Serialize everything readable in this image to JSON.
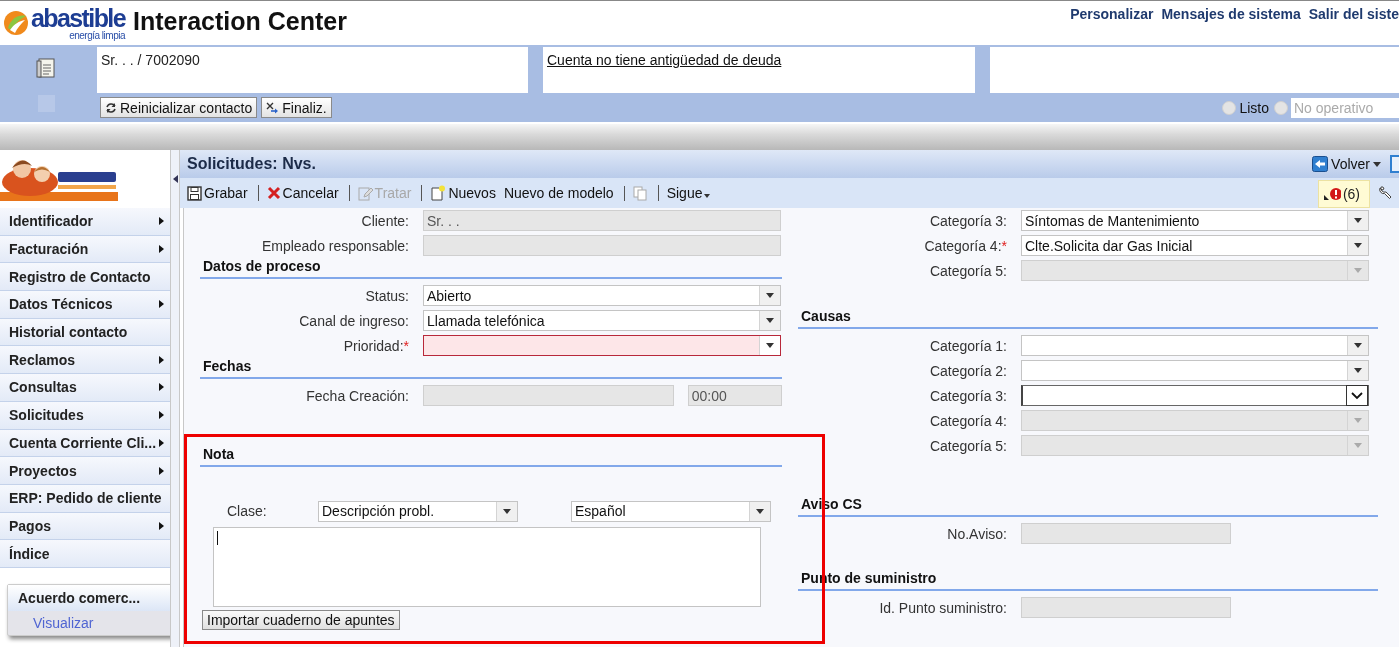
{
  "header": {
    "logo_text": "abastible",
    "logo_tagline": "energía limpia",
    "title": "Interaction Center",
    "links": [
      "Personalizar",
      "Mensajes de sistema",
      "Salir del siste"
    ]
  },
  "contact_bar": {
    "customer": "Sr. . . / 7002090",
    "debt_note": "Cuenta no tiene antigüedad de deuda",
    "buttons": [
      {
        "kind": "reset",
        "label": "Reinicializar contacto"
      },
      {
        "kind": "end",
        "label": "Finaliz."
      }
    ],
    "availability": [
      {
        "kind": "label",
        "label": "Listo",
        "selected": false
      },
      {
        "kind": "field",
        "placeholder": "No operativo",
        "selected": false
      }
    ]
  },
  "sidebar": {
    "items": [
      {
        "label": "Identificador",
        "submenu": true
      },
      {
        "label": "Facturación",
        "submenu": true
      },
      {
        "label": "Registro de Contacto",
        "submenu": false
      },
      {
        "label": "Datos Técnicos",
        "submenu": true
      },
      {
        "label": "Historial contacto",
        "submenu": false
      },
      {
        "label": "Reclamos",
        "submenu": true
      },
      {
        "label": "Consultas",
        "submenu": true
      },
      {
        "label": "Solicitudes",
        "submenu": true
      },
      {
        "label": "Cuenta Corriente Cli...",
        "submenu": true
      },
      {
        "label": "Proyectos",
        "submenu": true
      },
      {
        "label": "ERP: Pedido de cliente",
        "submenu": false
      },
      {
        "label": "Pagos",
        "submenu": true
      },
      {
        "label": "Índice",
        "submenu": false
      }
    ],
    "popup": {
      "title": "Acuerdo comerc...",
      "items": [
        "Visualizar"
      ]
    }
  },
  "page": {
    "title": "Solicitudes: Nvs.",
    "back": "Volver",
    "messages": "(6)",
    "toolbar": [
      {
        "kind": "save",
        "label": "Grabar",
        "disabled": false,
        "divider_before": false
      },
      {
        "kind": "cancel",
        "label": "Cancelar",
        "disabled": false,
        "divider_before": true
      },
      {
        "kind": "edit",
        "label": "Tratar",
        "disabled": true,
        "divider_before": true
      },
      {
        "kind": "new",
        "label": "Nuevos",
        "disabled": false,
        "divider_before": true
      },
      {
        "kind": "plain",
        "label": "Nuevo de modelo",
        "disabled": false,
        "divider_before": false
      },
      {
        "kind": "copy",
        "disabled": true,
        "divider_before": true
      },
      {
        "kind": "menu",
        "label": "Sigue",
        "disabled": false,
        "divider_before": true
      }
    ]
  },
  "left_sections": [
    {
      "fields": [
        {
          "label": "Cliente:",
          "value": "Sr. . .",
          "kind": "text",
          "disabled": true,
          "invalid": false,
          "focused": false
        },
        {
          "label": "Empleado responsable:",
          "kind": "text",
          "disabled": true,
          "invalid": false,
          "focused": false
        }
      ]
    },
    {
      "title": "Datos de proceso",
      "fields": [
        {
          "label": "Status:",
          "value": "Abierto",
          "kind": "dropdown",
          "disabled": false,
          "invalid": false,
          "focused": false
        },
        {
          "label": "Canal de ingreso:",
          "value": "Llamada telefónica",
          "kind": "dropdown",
          "disabled": false,
          "invalid": false,
          "focused": false
        },
        {
          "label": "Prioridad:",
          "required_mark": "*",
          "kind": "dropdown",
          "disabled": false,
          "invalid": true,
          "focused": false
        }
      ]
    },
    {
      "title": "Fechas",
      "fields": [
        {
          "label": "Fecha Creación:",
          "kind": "text",
          "time": "00:00",
          "disabled": true,
          "invalid": false,
          "focused": false
        }
      ]
    }
  ],
  "note": {
    "title": "Nota",
    "highlighted": true,
    "class_label": "Clase:",
    "class_value": "Descripción probl.",
    "language": "Español",
    "focused": true,
    "import_button": "Importar cuaderno de apuntes"
  },
  "right_sections": [
    {
      "fields": [
        {
          "label": "Categoría 3:",
          "value": "Síntomas de Mantenimiento",
          "kind": "dropdown",
          "disabled": false,
          "invalid": false,
          "focused": false
        },
        {
          "label": "Categoría 4:",
          "required_mark": "*",
          "value": "Clte.Solicita dar Gas Inicial",
          "kind": "dropdown",
          "disabled": false,
          "invalid": false,
          "focused": false
        },
        {
          "label": "Categoría 5:",
          "kind": "dropdown",
          "disabled": true,
          "invalid": false,
          "focused": false
        }
      ]
    },
    {
      "title": "Causas",
      "fields": [
        {
          "label": "Categoría 1:",
          "kind": "dropdown",
          "disabled": false,
          "invalid": false,
          "focused": false
        },
        {
          "label": "Categoría 2:",
          "kind": "dropdown",
          "disabled": false,
          "invalid": false,
          "focused": false
        },
        {
          "label": "Categoría 3:",
          "kind": "dropdown",
          "disabled": false,
          "invalid": false,
          "focused": true
        },
        {
          "label": "Categoría 4:",
          "kind": "dropdown",
          "disabled": true,
          "invalid": false,
          "focused": false
        },
        {
          "label": "Categoría 5:",
          "kind": "dropdown",
          "disabled": true,
          "invalid": false,
          "focused": false
        }
      ]
    },
    {
      "title": "Aviso CS",
      "fields": [
        {
          "label": "No.Aviso:",
          "kind": "text",
          "short": true,
          "disabled": true,
          "invalid": false,
          "focused": false
        }
      ]
    },
    {
      "title": "Punto de suministro",
      "fields": [
        {
          "label": "Id. Punto suministro:",
          "kind": "text",
          "short": true,
          "disabled": true,
          "invalid": false,
          "focused": false
        }
      ]
    }
  ]
}
